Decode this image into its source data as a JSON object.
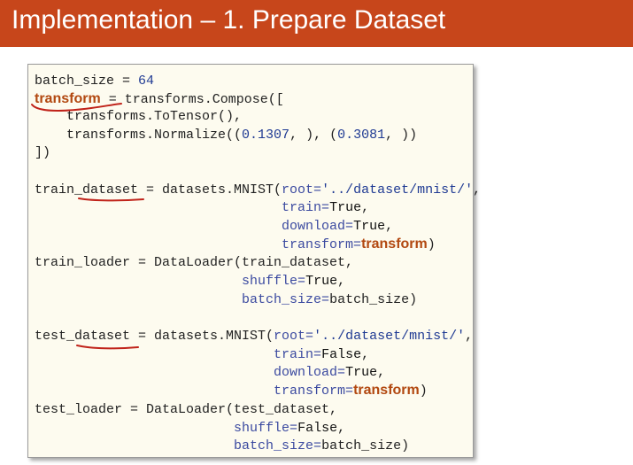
{
  "slide": {
    "title": "Implementation – 1. Prepare Dataset"
  },
  "code": {
    "l1": {
      "a": "batch_size = ",
      "b": "64"
    },
    "l2": {
      "a": "transform",
      "b": " = transforms.Compose(["
    },
    "l3": {
      "a": "    transforms.ToTensor(),"
    },
    "l4": {
      "a": "    transforms.Normalize((",
      "b": "0.1307",
      "c": ", ), (",
      "d": "0.3081",
      "e": ", ))"
    },
    "l5": {
      "a": "])"
    },
    "l7": {
      "a": "train_dataset = datasets.MNIST(",
      "b": "root=",
      "c": "'../dataset/mnist/'",
      "d": ","
    },
    "l8": {
      "a": "                               ",
      "b": "train=",
      "c": "True",
      "d": ","
    },
    "l9": {
      "a": "                               ",
      "b": "download=",
      "c": "True",
      "d": ","
    },
    "l10": {
      "a": "                               ",
      "b": "transform=",
      "c": "transform",
      "d": ")"
    },
    "l11": {
      "a": "train_loader = DataLoader(train_dataset,"
    },
    "l12": {
      "a": "                          ",
      "b": "shuffle=",
      "c": "True",
      "d": ","
    },
    "l13": {
      "a": "                          ",
      "b": "batch_size=",
      "c": "batch_size)"
    },
    "l15": {
      "a": "test_dataset = datasets.MNIST(",
      "b": "root=",
      "c": "'../dataset/mnist/'",
      "d": ","
    },
    "l16": {
      "a": "                              ",
      "b": "train=",
      "c": "False",
      "d": ","
    },
    "l17": {
      "a": "                              ",
      "b": "download=",
      "c": "True",
      "d": ","
    },
    "l18": {
      "a": "                              ",
      "b": "transform=",
      "c": "transform",
      "d": ")"
    },
    "l19": {
      "a": "test_loader = DataLoader(test_dataset,"
    },
    "l20": {
      "a": "                         ",
      "b": "shuffle=",
      "c": "False",
      "d": ","
    },
    "l21": {
      "a": "                         ",
      "b": "batch_size=",
      "c": "batch_size)"
    }
  },
  "colors": {
    "title_bar": "#c7461b",
    "code_background": "#fdfbef",
    "annotation_ink": "#c0231a"
  }
}
